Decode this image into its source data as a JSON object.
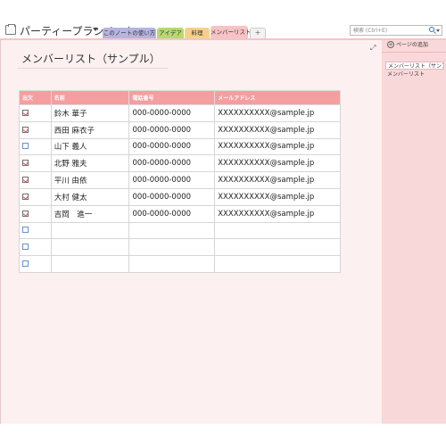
{
  "notebook": {
    "title": "パーティープランノート"
  },
  "tabs": [
    {
      "label": "このノートの使い方"
    },
    {
      "label": "アイデア"
    },
    {
      "label": "料理"
    },
    {
      "label": "メンバーリスト"
    },
    {
      "label": "+"
    }
  ],
  "search": {
    "placeholder": "検索 (Ctrl+E)"
  },
  "page": {
    "title": "メンバーリスト（サンプル）",
    "table": {
      "headers": [
        "出欠",
        "名前",
        "電話番号",
        "メールアドレス"
      ],
      "rows": [
        {
          "checked": true,
          "name": "鈴木 華子",
          "phone": "000-0000-0000",
          "email": "XXXXXXXXXX@sample.jp"
        },
        {
          "checked": true,
          "name": "西田 麻衣子",
          "phone": "000-0000-0000",
          "email": "XXXXXXXXXX@sample.jp"
        },
        {
          "checked": false,
          "name": "山下 義人",
          "phone": "000-0000-0000",
          "email": "XXXXXXXXXX@sample.jp"
        },
        {
          "checked": true,
          "name": "北野 雅夫",
          "phone": "000-0000-0000",
          "email": "XXXXXXXXXX@sample.jp"
        },
        {
          "checked": true,
          "name": "平川 由依",
          "phone": "000-0000-0000",
          "email": "XXXXXXXXXX@sample.jp"
        },
        {
          "checked": true,
          "name": "大村 健太",
          "phone": "000-0000-0000",
          "email": "XXXXXXXXXX@sample.jp"
        },
        {
          "checked": true,
          "name": "吉岡　進一",
          "phone": "000-0000-0000",
          "email": "XXXXXXXXXX@sample.jp"
        },
        {
          "checked": false,
          "name": "",
          "phone": "",
          "email": ""
        },
        {
          "checked": false,
          "name": "",
          "phone": "",
          "email": ""
        },
        {
          "checked": false,
          "name": "",
          "phone": "",
          "email": ""
        }
      ]
    }
  },
  "pages_panel": {
    "add_label": "ページの追加",
    "items": [
      {
        "label": "メンバーリスト（サンプル"
      },
      {
        "label": "メンバーリスト"
      }
    ]
  },
  "colors": {
    "tab_1": "#b7b4e0",
    "tab_2": "#b7d96d",
    "tab_3": "#f6d08a",
    "tab_active": "#f7c3c5",
    "table_header": "#f59ea0",
    "page_bg": "#fdf0f1",
    "panel_bg": "#f9d8da"
  },
  "icons": {
    "notebook": "notebook-icon",
    "dropdown": "chevron-down-icon",
    "search": "search-icon",
    "expand": "expand-icon",
    "add_page": "add-circle-icon"
  }
}
